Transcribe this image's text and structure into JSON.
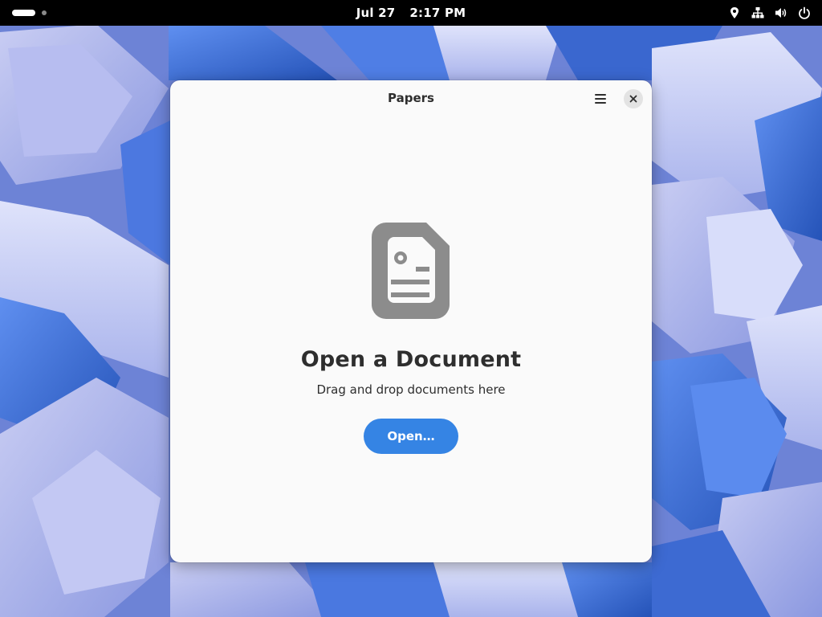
{
  "topbar": {
    "date": "Jul 27",
    "time": "2:17 PM",
    "icons": [
      "location-icon",
      "network-wired-icon",
      "volume-icon",
      "power-icon"
    ]
  },
  "window": {
    "title": "Papers",
    "menu_icon": "hamburger-menu-icon",
    "close_icon": "close-icon"
  },
  "status_page": {
    "icon": "document-icon",
    "title": "Open a Document",
    "description": "Drag and drop documents here",
    "button_label": "Open…"
  },
  "colors": {
    "accent": "#3584e4",
    "window_bg": "#fafafa",
    "topbar_bg": "#000000",
    "icon_gray": "#8c8c8c"
  }
}
